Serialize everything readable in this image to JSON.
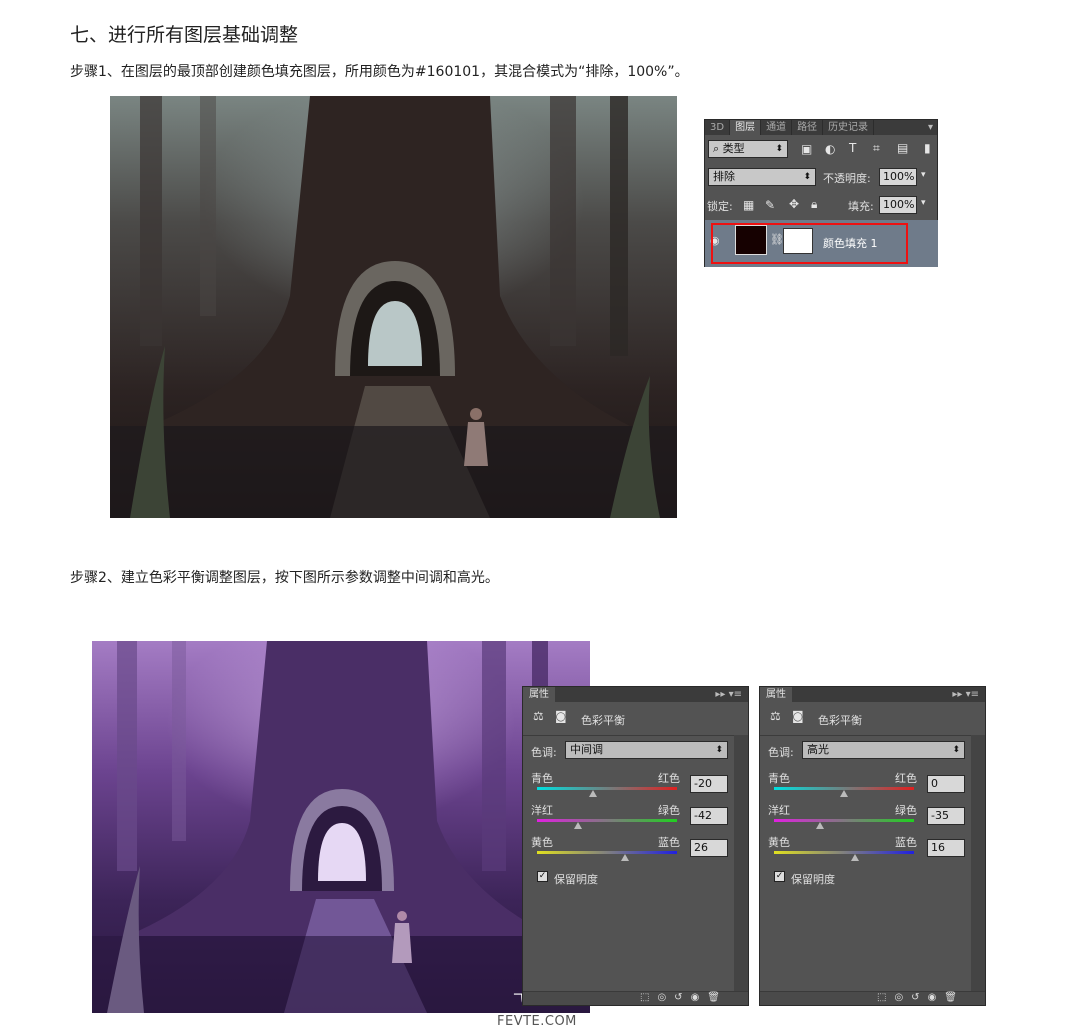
{
  "heading": "七、进行所有图层基础调整",
  "step1": "步骤1、在图层的最顶部创建颜色填充图层，所用颜色为#160101，其混合模式为“排除，100%”。",
  "step2": "步骤2、建立色彩平衡调整图层，按下图所示参数调整中间调和高光。",
  "layers_panel": {
    "tabs": [
      "3D",
      "图层",
      "通道",
      "路径",
      "历史记录"
    ],
    "active_tab": "图层",
    "filter": "类型",
    "blend_mode": "排除",
    "opacity_label": "不透明度:",
    "opacity": "100%",
    "lock_label": "锁定:",
    "fill_label": "填充:",
    "fill": "100%",
    "layer_name": "颜色填充 1",
    "fill_color": "#160101"
  },
  "props_panels": [
    {
      "tab": "属性",
      "title": "色彩平衡",
      "tone_label": "色调:",
      "tone": "中间调",
      "sliders": [
        {
          "left": "青色",
          "right": "红色",
          "value": "-20",
          "level": -20
        },
        {
          "left": "洋红",
          "right": "绿色",
          "value": "-42",
          "level": -42
        },
        {
          "left": "黄色",
          "right": "蓝色",
          "value": "26",
          "level": 26
        }
      ],
      "preserve_label": "保留明度"
    },
    {
      "tab": "属性",
      "title": "色彩平衡",
      "tone_label": "色调:",
      "tone": "高光",
      "sliders": [
        {
          "left": "青色",
          "right": "红色",
          "value": "0",
          "level": 0
        },
        {
          "left": "洋红",
          "right": "绿色",
          "value": "-35",
          "level": -35
        },
        {
          "left": "黄色",
          "right": "蓝色",
          "value": "16",
          "level": 16
        }
      ],
      "preserve_label": "保留明度"
    }
  ],
  "watermark": {
    "line1": "飞特网",
    "line2": "FEVTE.COM"
  }
}
